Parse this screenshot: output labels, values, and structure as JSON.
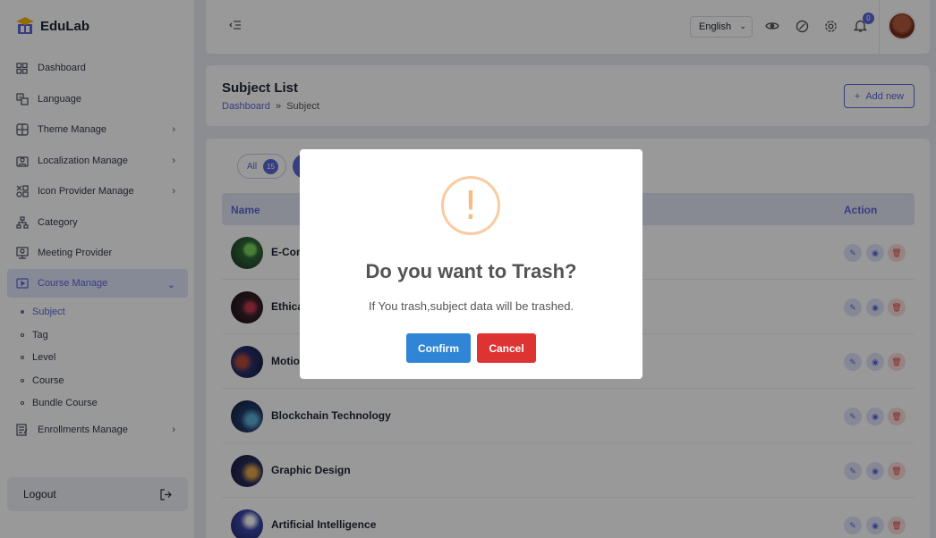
{
  "app": {
    "name": "EduLab"
  },
  "sidebar": {
    "items": [
      {
        "label": "Dashboard",
        "icon": "grid-icon"
      },
      {
        "label": "Language",
        "icon": "translate-icon"
      },
      {
        "label": "Theme Manage",
        "icon": "theme-icon",
        "has_children": true
      },
      {
        "label": "Localization Manage",
        "icon": "localization-icon",
        "has_children": true
      },
      {
        "label": "Icon Provider Manage",
        "icon": "icon-provider-icon",
        "has_children": true
      },
      {
        "label": "Category",
        "icon": "category-icon"
      },
      {
        "label": "Meeting Provider",
        "icon": "meeting-icon"
      },
      {
        "label": "Course Manage",
        "icon": "course-icon",
        "has_children": true,
        "active": true
      }
    ],
    "course_sub": [
      {
        "label": "Subject",
        "active": true
      },
      {
        "label": "Tag"
      },
      {
        "label": "Level"
      },
      {
        "label": "Course"
      },
      {
        "label": "Bundle Course"
      }
    ],
    "after": [
      {
        "label": "Enrollments Manage",
        "icon": "enrollment-icon",
        "has_children": true
      }
    ],
    "logout": "Logout"
  },
  "header": {
    "language": "English",
    "notification_count": "0"
  },
  "page": {
    "title": "Subject List",
    "breadcrumb": {
      "home": "Dashboard",
      "sep": "»",
      "current": "Subject"
    },
    "add_new": "Add new"
  },
  "table": {
    "filter": {
      "label": "All",
      "count": "15"
    },
    "headers": {
      "name": "Name",
      "action": "Action"
    },
    "rows": [
      {
        "name": "E-Com",
        "color": "#2f6b3a"
      },
      {
        "name": "Ethica",
        "color": "#3a1f2c"
      },
      {
        "name": "Motio",
        "color": "#2a2f6b"
      },
      {
        "name": "Blockchain Technology",
        "color": "#213a66"
      },
      {
        "name": "Graphic Design",
        "color": "#2a2f5b"
      },
      {
        "name": "Artificial Intelligence",
        "color": "#3b46a8"
      }
    ]
  },
  "modal": {
    "icon": "!",
    "title": "Do you want to Trash?",
    "text": "If You trash,subject data will be trashed.",
    "confirm": "Confirm",
    "cancel": "Cancel"
  },
  "colors": {
    "accent": "#5b67d8",
    "confirm": "#3085d6",
    "cancel": "#dd3333",
    "warning": "#f8bb86"
  }
}
